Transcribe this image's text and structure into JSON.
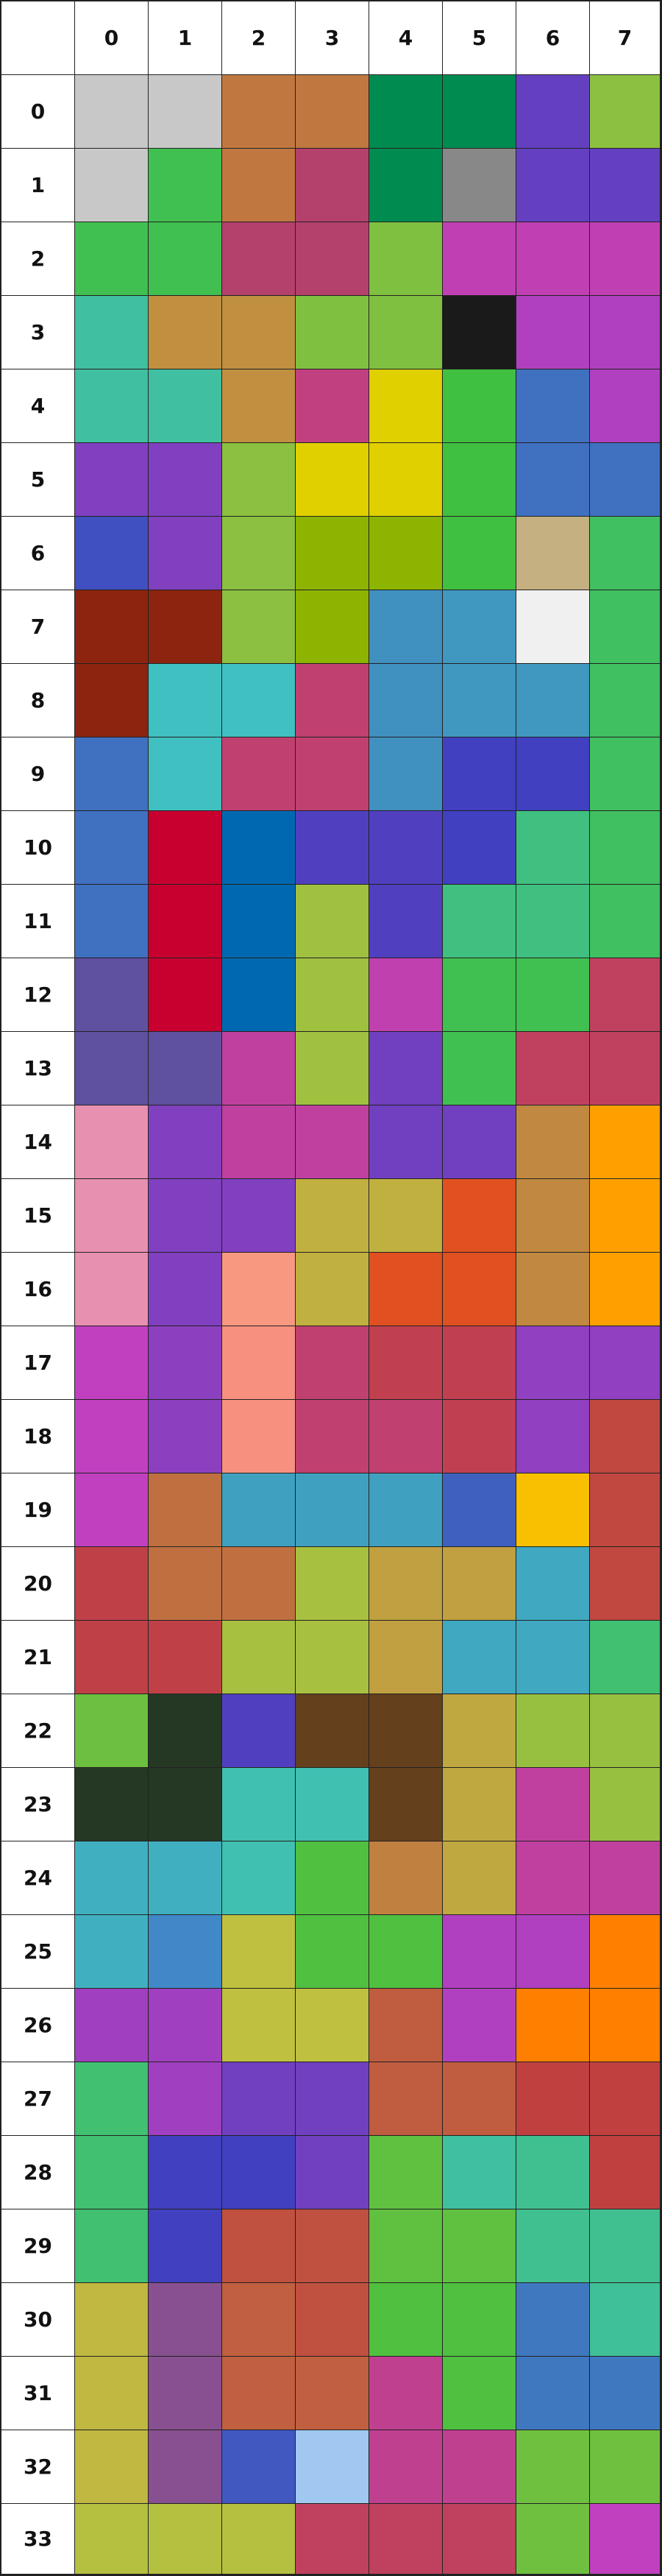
{
  "column_labels": [
    "0",
    "1",
    "2",
    "3",
    "4",
    "5",
    "6",
    "7"
  ],
  "row_labels": [
    "0",
    "1",
    "2",
    "3",
    "4",
    "5",
    "6",
    "7",
    "8",
    "9",
    "10",
    "11",
    "12",
    "13",
    "14",
    "15",
    "16",
    "17",
    "18",
    "19",
    "20",
    "21",
    "22",
    "23",
    "24",
    "25",
    "26",
    "27",
    "28",
    "29",
    "30",
    "31",
    "32",
    "33"
  ],
  "grid": [
    [
      "#c8c8c8",
      "#c8c8c8",
      "#c07840",
      "#c07840",
      "#008c50",
      "#008c50",
      "#6440c0",
      "#8cc040"
    ],
    [
      "#c8c8c8",
      "#40c050",
      "#c07840",
      "#b4406c",
      "#008c50",
      "#888888",
      "#6440c0",
      "#6440c0"
    ],
    [
      "#40c050",
      "#40c050",
      "#b4406c",
      "#b4406c",
      "#80c040",
      "#c040b4",
      "#c040b4",
      "#c040b4"
    ],
    [
      "#40c0a0",
      "#c09040",
      "#c09040",
      "#80c040",
      "#80c040",
      "#1a1a1a",
      "#b040c0",
      "#b040c0"
    ],
    [
      "#40c0a0",
      "#40c0a0",
      "#c09040",
      "#c04080",
      "#e0d000",
      "#40c040",
      "#4070c0",
      "#b040c0"
    ],
    [
      "#8040c0",
      "#8040c0",
      "#8cc040",
      "#e0d000",
      "#e0d000",
      "#40c040",
      "#4070c0",
      "#4070c0"
    ],
    [
      "#4050c0",
      "#8040c0",
      "#8cc040",
      "#8cb400",
      "#8cb400",
      "#40c040",
      "#c4b080",
      "#40c060"
    ],
    [
      "#8c2410",
      "#8c2410",
      "#8cc040",
      "#8cb400",
      "#4090c0",
      "#4098c0",
      "#f0f0f0",
      "#40c060"
    ],
    [
      "#8c2410",
      "#40c0c0",
      "#40c0c0",
      "#c04070",
      "#4090c0",
      "#4098c0",
      "#4098c0",
      "#40c060"
    ],
    [
      "#4070c0",
      "#40c0c0",
      "#c04070",
      "#c04070",
      "#4090c0",
      "#4040c0",
      "#4040c0",
      "#40c060"
    ],
    [
      "#4070c0",
      "#c80030",
      "#0068b0",
      "#5040c0",
      "#5040c0",
      "#4040c0",
      "#40c080",
      "#40c060"
    ],
    [
      "#4070c0",
      "#c80030",
      "#0068b0",
      "#a0c040",
      "#5040c0",
      "#40c080",
      "#40c080",
      "#40c060"
    ],
    [
      "#6050a0",
      "#c80030",
      "#0068b0",
      "#a0c040",
      "#c040b0",
      "#40c050",
      "#40c050",
      "#c04060"
    ],
    [
      "#6050a0",
      "#6050a0",
      "#c040a0",
      "#a0c040",
      "#7040c0",
      "#40c050",
      "#c04060",
      "#c04060"
    ],
    [
      "#e890b0",
      "#8040c0",
      "#c040a0",
      "#c040a0",
      "#7040c0",
      "#7040c0",
      "#c08840",
      "#ffa000"
    ],
    [
      "#e890b0",
      "#8040c0",
      "#8040c0",
      "#c0b040",
      "#c0b040",
      "#e05020",
      "#c08840",
      "#ffa000"
    ],
    [
      "#e890b0",
      "#8040c0",
      "#f89880",
      "#c0b040",
      "#e05020",
      "#e05020",
      "#c08840",
      "#ffa000"
    ],
    [
      "#c040c0",
      "#8c40c0",
      "#f89080",
      "#c04070",
      "#c04050",
      "#c04050",
      "#9040c0",
      "#9040c0"
    ],
    [
      "#c040c0",
      "#8c40c0",
      "#f89080",
      "#c04070",
      "#c04070",
      "#c04050",
      "#9040c0",
      "#c04840"
    ],
    [
      "#c040c0",
      "#c07040",
      "#40a0c0",
      "#40a0c0",
      "#40a0c0",
      "#4060c0",
      "#f8c000",
      "#c04840"
    ],
    [
      "#c04048",
      "#c07040",
      "#c07040",
      "#a8c040",
      "#c0a040",
      "#c0a040",
      "#40a8c0",
      "#c04840"
    ],
    [
      "#c04048",
      "#c04048",
      "#a8c040",
      "#a8c040",
      "#c0a040",
      "#40a8c0",
      "#40a8c0",
      "#40c070"
    ],
    [
      "#6cc040",
      "#243824",
      "#5040c0",
      "#64401c",
      "#64401c",
      "#c0a840",
      "#98c040",
      "#98c040"
    ],
    [
      "#243824",
      "#243824",
      "#40c0b0",
      "#40c0b0",
      "#64401c",
      "#c0a840",
      "#c040a0",
      "#98c040"
    ],
    [
      "#40b0c0",
      "#40b0c0",
      "#40c0b0",
      "#50c040",
      "#c08040",
      "#c0a840",
      "#c040a0",
      "#c040a0"
    ],
    [
      "#40b0c0",
      "#4088c8",
      "#c0c040",
      "#50c040",
      "#50c040",
      "#b040c0",
      "#b040c0",
      "#ff8000"
    ],
    [
      "#a040c0",
      "#a040c0",
      "#c0c040",
      "#c0c040",
      "#c05c40",
      "#b040c0",
      "#ff8000",
      "#ff8000"
    ],
    [
      "#40c070",
      "#a040c0",
      "#7040c0",
      "#7040c0",
      "#c05c40",
      "#c05c40",
      "#c04040",
      "#c04040"
    ],
    [
      "#40c070",
      "#4040c0",
      "#4040c0",
      "#7040c0",
      "#60c040",
      "#40c0a0",
      "#40c090",
      "#c04040"
    ],
    [
      "#40c070",
      "#4040c0",
      "#c05040",
      "#c05040",
      "#60c040",
      "#60c040",
      "#40c090",
      "#40c090"
    ],
    [
      "#c0b840",
      "#885090",
      "#c06040",
      "#c05040",
      "#50c040",
      "#50c040",
      "#4078c0",
      "#40c098"
    ],
    [
      "#c0b840",
      "#885090",
      "#c06040",
      "#c06040",
      "#c04090",
      "#50c040",
      "#4078c0",
      "#4078c0"
    ],
    [
      "#c0b840",
      "#885090",
      "#4058c0",
      "#a0c8f0",
      "#c04090",
      "#c04090",
      "#70c040",
      "#70c040"
    ],
    [
      "#b4c040",
      "#b4c040",
      "#b4c040",
      "#c04060",
      "#c04060",
      "#c04060",
      "#70c040",
      "#c040c0"
    ]
  ]
}
